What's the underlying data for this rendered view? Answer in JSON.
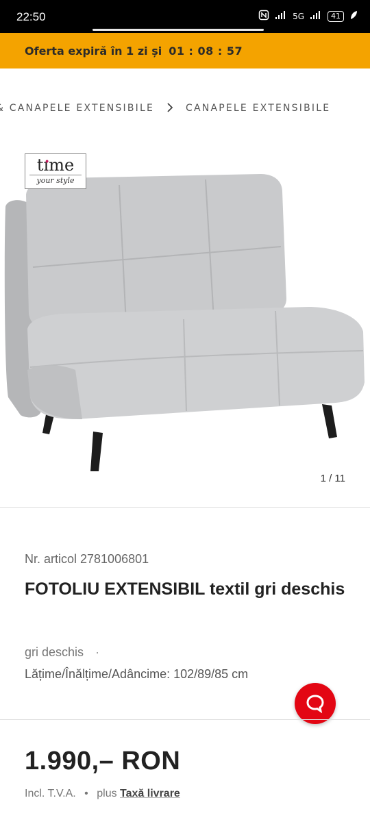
{
  "status_bar": {
    "time": "22:50",
    "network": "5G",
    "battery": "41"
  },
  "offer": {
    "text": "Oferta expiră în 1 zi și",
    "countdown": "01 : 08 : 57"
  },
  "breadcrumb": {
    "items": [
      "& CANAPELE EXTENSIBILE",
      "CANAPELE EXTENSIBILE"
    ]
  },
  "gallery": {
    "brand_main": "ti me",
    "brand_sub": "your style",
    "pager": "1 / 11",
    "product_color": "#c9cacc"
  },
  "product": {
    "article_number": "Nr. articol 2781006801",
    "title_bold": "FOTOLIU",
    "title_rest": " EXTENSIBIL textil gri deschis",
    "color": "gri deschis",
    "color_sep": "·",
    "dimensions": "Lățime/Înălțime/Adâncime: 102/89/85 cm"
  },
  "pricing": {
    "price": "1.990,– RON",
    "vat": "Incl. T.V.A.",
    "bullet": "•",
    "plus": "plus",
    "delivery_link": "Taxă livrare"
  },
  "colors": {
    "offer_bar": "#f4a300",
    "chat_button": "#e30613"
  }
}
